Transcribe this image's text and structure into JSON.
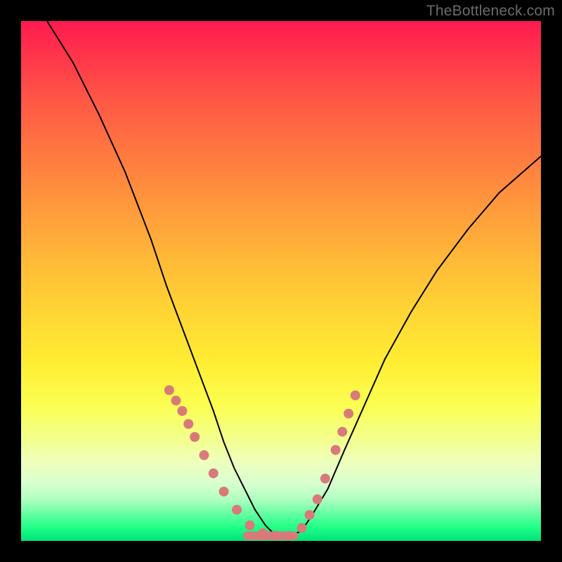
{
  "watermark": "TheBottleneck.com",
  "chart_data": {
    "type": "line",
    "title": "",
    "xlabel": "",
    "ylabel": "",
    "xlim": [
      0,
      100
    ],
    "ylim": [
      0,
      100
    ],
    "grid": false,
    "legend": false,
    "series": [
      {
        "name": "curve",
        "x": [
          5,
          10,
          15,
          20,
          25,
          28,
          31,
          34,
          37,
          39,
          41,
          43,
          45,
          47,
          49,
          52,
          54,
          56,
          59,
          62,
          66,
          70,
          75,
          80,
          86,
          92,
          100
        ],
        "y": [
          100,
          92,
          82,
          71,
          58,
          49,
          41,
          33,
          25,
          19,
          14,
          10,
          6,
          3,
          1,
          1,
          2,
          5,
          10,
          17,
          26,
          35,
          44,
          52,
          60,
          67,
          74
        ]
      }
    ],
    "markers": {
      "name": "dots",
      "color_hex": "#d97a7a",
      "x": [
        28.5,
        29.8,
        31.0,
        32.2,
        33.4,
        35.2,
        37.0,
        39.0,
        41.5,
        44.0,
        46.5,
        49.0,
        51.5,
        54.0,
        55.5,
        57.0,
        58.5,
        60.5,
        61.8,
        63.0,
        64.3
      ],
      "y": [
        29.0,
        27.0,
        25.0,
        22.5,
        20.0,
        16.5,
        13.0,
        9.5,
        6.0,
        3.0,
        1.5,
        1.0,
        1.0,
        2.5,
        5.0,
        8.0,
        12.0,
        17.5,
        21.0,
        24.5,
        28.0
      ]
    },
    "flat_segment": {
      "x0": 43.5,
      "x1": 52.5,
      "y": 1.0,
      "color_hex": "#d97a7a"
    }
  }
}
